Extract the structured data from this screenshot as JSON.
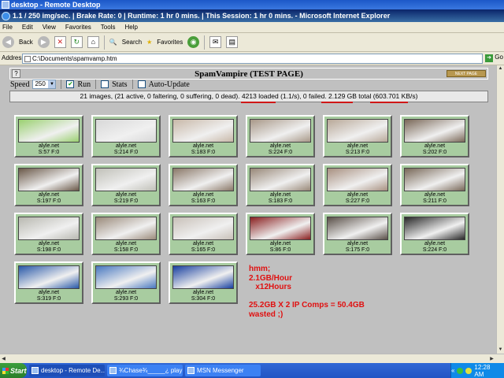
{
  "remote_title": "desktop - Remote Desktop",
  "window_title": "1.1 / 250 img/sec.  |  Brake Rate: 0  |  Runtime: 1 hr 0 mins.  |  This Session: 1 hr 0 mins. - Microsoft Internet Explorer",
  "menu": [
    "File",
    "Edit",
    "View",
    "Favorites",
    "Tools",
    "Help"
  ],
  "toolbar": {
    "back": "Back",
    "search": "Search",
    "favorites": "Favorites"
  },
  "address": {
    "label": "Address",
    "value": "C:\\Documents\\spamvamp.htm",
    "go": "Go"
  },
  "page": {
    "title": "SpamVampire (TEST PAGE)",
    "help": "?",
    "next_badge": "NEXT PAGE",
    "speed_label": "Speed",
    "speed_value": "250",
    "run_label": "Run",
    "run_checked": true,
    "stats_label": "Stats",
    "stats_checked": false,
    "autoupdate_label": "Auto-Update",
    "autoupdate_checked": false,
    "status": "21 images, (21 active, 0 faltering, 0 suffering, 0 dead). 4213 loaded (1.1/s), 0 failed. 2.129 GB total (603.701 KB/s)"
  },
  "thumbnails": [
    {
      "site": "alyle.net",
      "stats": "S:57  F:0",
      "color": "#9ad070"
    },
    {
      "site": "alyle.net",
      "stats": "S:214  F:0",
      "color": "#d8d8d8"
    },
    {
      "site": "alyle.net",
      "stats": "S:183  F:0",
      "color": "#c8b8a8"
    },
    {
      "site": "alyle.net",
      "stats": "S:224  F:0",
      "color": "#a89888"
    },
    {
      "site": "alyle.net",
      "stats": "S:213  F:0",
      "color": "#b8a898"
    },
    {
      "site": "alyle.net",
      "stats": "S:202  F:0",
      "color": "#7a6858"
    },
    {
      "site": "alyle.net",
      "stats": "S:197  F:0",
      "color": "#6a5848"
    },
    {
      "site": "alyle.net",
      "stats": "S:219  F:0",
      "color": "#c0c0b8"
    },
    {
      "site": "alyle.net",
      "stats": "S:163  F:0",
      "color": "#8a7868"
    },
    {
      "site": "alyle.net",
      "stats": "S:183  F:0",
      "color": "#988878"
    },
    {
      "site": "alyle.net",
      "stats": "S:227  F:0",
      "color": "#a89080"
    },
    {
      "site": "alyle.net",
      "stats": "S:211  F:0",
      "color": "#786858"
    },
    {
      "site": "alyle.net",
      "stats": "S:198  F:0",
      "color": "#b8b8b0"
    },
    {
      "site": "alyle.net",
      "stats": "S:158  F:0",
      "color": "#9a8a7a"
    },
    {
      "site": "alyle.net",
      "stats": "S:165  F:0",
      "color": "#c8c0b8"
    },
    {
      "site": "alyle.net",
      "stats": "S:86  F:0",
      "color": "#8a2020"
    },
    {
      "site": "alyle.net",
      "stats": "S:175  F:0",
      "color": "#5a5048"
    },
    {
      "site": "alyle.net",
      "stats": "S:224  F:0",
      "color": "#282828"
    },
    {
      "site": "alyle.net",
      "stats": "S:319  F:0",
      "color": "#2858a8"
    },
    {
      "site": "alyle.net",
      "stats": "S:293  F:0",
      "color": "#4878c0"
    },
    {
      "site": "alyle.net",
      "stats": "S:304  F:0",
      "color": "#1840a0"
    }
  ],
  "annotation": [
    "hmm;",
    "2.1GB/Hour",
    "   x12Hours",
    "",
    "25.2GB X 2 IP Comps = 50.4GB",
    "wasted ;)"
  ],
  "taskbar": {
    "start": "Start",
    "tasks": [
      "desktop - Remote De...",
      "¾Chase¾_____¿ playi...",
      "MSN Messenger"
    ],
    "clock": "12:28 AM"
  }
}
